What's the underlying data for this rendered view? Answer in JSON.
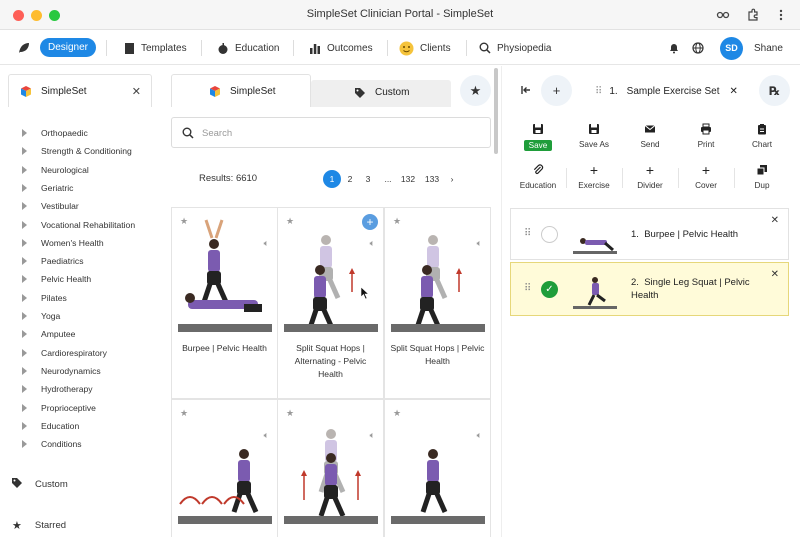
{
  "window": {
    "title": "SimpleSet Clinician Portal - SimpleSet"
  },
  "navbar": {
    "designer": "Designer",
    "templates": "Templates",
    "education": "Education",
    "outcomes": "Outcomes",
    "clients": "Clients",
    "physiopedia": "Physiopedia",
    "avatar_initials": "SD",
    "user_name": "Shane"
  },
  "left_panel": {
    "tab_label": "SimpleSet",
    "categories": [
      "Orthopaedic",
      "Strength & Conditioning",
      "Neurological",
      "Geriatric",
      "Vestibular",
      "Vocational Rehabilitation",
      "Women's Health",
      "Paediatrics",
      "Pelvic Health",
      "Pilates",
      "Yoga",
      "Amputee",
      "Cardiorespiratory",
      "Neurodynamics",
      "Hydrotherapy",
      "Proprioceptive",
      "Education",
      "Conditions"
    ],
    "custom": "Custom",
    "starred": "Starred"
  },
  "library": {
    "tab_simpleset": "SimpleSet",
    "tab_custom": "Custom",
    "search_placeholder": "Search",
    "results": "Results: 6610",
    "pages": [
      "1",
      "2",
      "3",
      "...",
      "132",
      "133"
    ],
    "current_page": "1",
    "cards": [
      {
        "title": "Burpee | Pelvic Health"
      },
      {
        "title": "Split Squat Hops | Alternating - Pelvic Health"
      },
      {
        "title": "Split Squat Hops | Pelvic Health"
      },
      {
        "title": ""
      },
      {
        "title": ""
      },
      {
        "title": ""
      }
    ]
  },
  "set_panel": {
    "tab_number": "1.",
    "tab_name": "Sample Exercise Set",
    "tools_row1": [
      "Save",
      "Save As",
      "Send",
      "Print",
      "Chart"
    ],
    "tools_row2": [
      "Education",
      "Exercise",
      "Divider",
      "Cover",
      "Dup"
    ],
    "items": [
      {
        "number": "1.",
        "title": "Burpee | Pelvic Health",
        "selected": false
      },
      {
        "number": "2.",
        "title": "Single Leg Squat | Pelvic Health",
        "selected": true
      }
    ]
  },
  "colors": {
    "accent": "#1e88e5",
    "save_green": "#1f9d3a",
    "selected_row": "#fffbd9"
  }
}
